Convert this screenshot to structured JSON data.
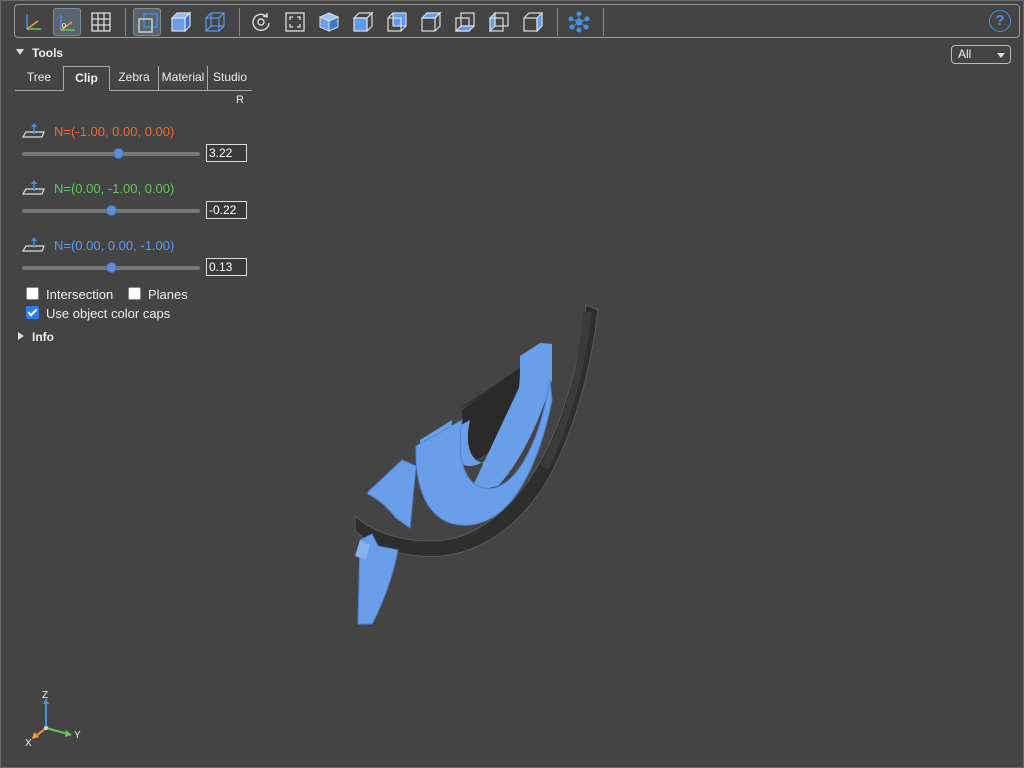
{
  "toolbar": {
    "buttons": [
      {
        "name": "axes-toggle-icon"
      },
      {
        "name": "axes-origin-icon",
        "active": true
      },
      {
        "name": "grid-icon"
      },
      {
        "name": "perspective-camera-icon",
        "active": true
      },
      {
        "name": "box-shaded-icon"
      },
      {
        "name": "box-transparent-icon"
      },
      {
        "name": "reset-view-icon"
      },
      {
        "name": "fit-view-icon"
      },
      {
        "name": "iso-view-icon"
      },
      {
        "name": "front-view-icon"
      },
      {
        "name": "rear-view-icon"
      },
      {
        "name": "top-view-icon"
      },
      {
        "name": "bottom-view-icon"
      },
      {
        "name": "left-view-icon"
      },
      {
        "name": "right-view-icon"
      },
      {
        "name": "explode-icon"
      }
    ],
    "help_label": "?"
  },
  "tools": {
    "title": "Tools",
    "tabs": [
      "Tree",
      "Clip",
      "Zebra",
      "Material",
      "Studio"
    ],
    "selected_tab": "Clip",
    "r_label": "R",
    "planes": [
      {
        "normal": "N=(-1.00, 0.00, 0.00)",
        "value": "3.22",
        "color": "#f06a2e",
        "slider_fraction": 0.54
      },
      {
        "normal": "N=(0.00, -1.00, 0.00)",
        "value": "-0.22",
        "color": "#5ec95a",
        "slider_fraction": 0.5
      },
      {
        "normal": "N=(0.00, 0.00, -1.00)",
        "value": "0.13",
        "color": "#5b9cf0",
        "slider_fraction": 0.5
      }
    ],
    "intersection_label": "Intersection",
    "intersection_checked": false,
    "planes_label": "Planes",
    "planes_checked": false,
    "object_color_caps_label": "Use object color caps",
    "object_color_caps_checked": true
  },
  "info": {
    "title": "Info"
  },
  "view_select": {
    "value": "All"
  },
  "axes_indicator": {
    "x": "X",
    "y": "Y",
    "z": "Z"
  },
  "colors": {
    "background": "#444444",
    "model_blue": "#6a9ee8",
    "model_dark": "#2e2e2e",
    "accent": "#4d8fdb"
  }
}
